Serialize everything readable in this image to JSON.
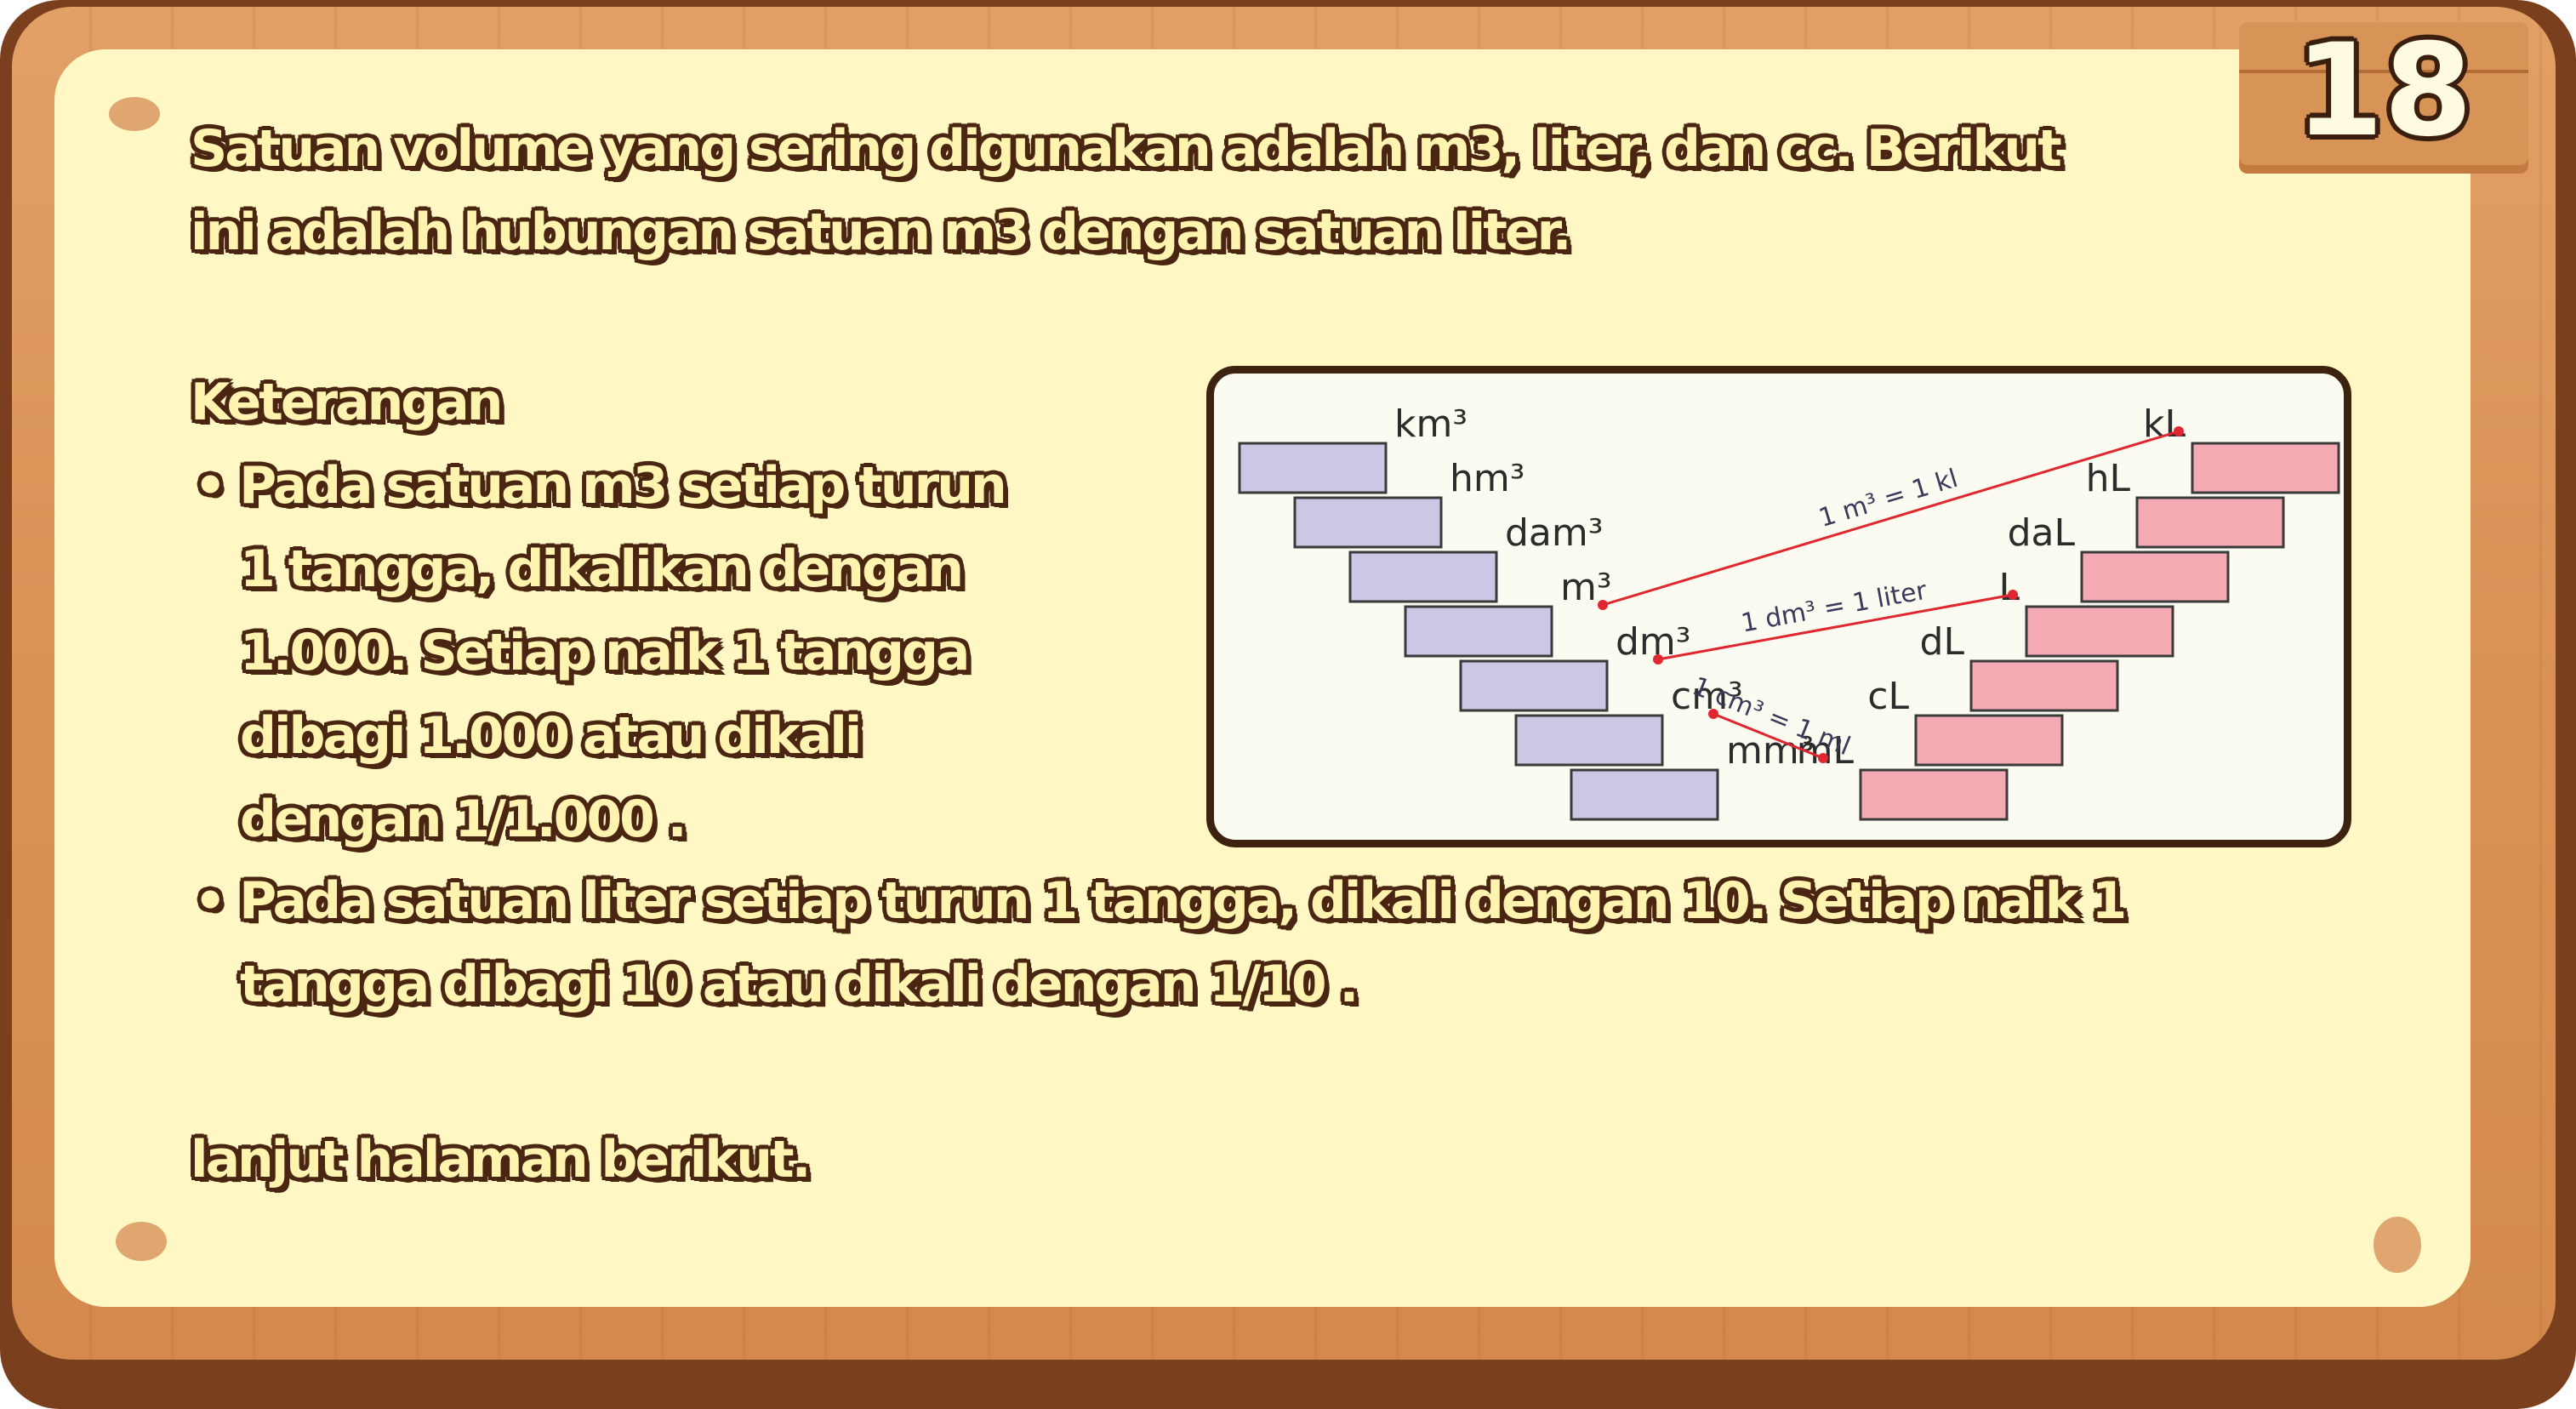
{
  "page_number": "18",
  "intro": {
    "line1": "Satuan volume yang sering digunakan adalah m3, liter, dan cc. Berikut",
    "line2": "ini adalah hubungan satuan m3 dengan satuan liter."
  },
  "keterangan": {
    "title": "Keterangan",
    "bullet1": [
      "• Pada satuan m3 setiap turun",
      "1 tangga, dikalikan dengan",
      "1.000. Setiap naik 1 tangga",
      "dibagi 1.000 atau dikali",
      "dengan 1/1.000 ."
    ],
    "bullet2": [
      "• Pada satuan liter setiap turun 1 tangga, dikali dengan 10. Setiap naik 1",
      "tangga dibagi 10 atau dikali dengan 1/10 ."
    ]
  },
  "outro": "lanjut halaman berikut.",
  "diagram": {
    "volume_units": [
      "km³",
      "hm³",
      "dam³",
      "m³",
      "dm³",
      "cm³",
      "mm³"
    ],
    "liter_units": [
      "kL",
      "hL",
      "daL",
      "L",
      "dL",
      "cL",
      "mL"
    ],
    "relations": [
      "1 m³ = 1 kl",
      "1 dm³ = 1 liter",
      "1 cm³ = 1 ml"
    ],
    "colors": {
      "volume_step": "#cbc8e6",
      "liter_step": "#f4aab3",
      "relation_line": "#e0262e",
      "frame": "#3e2210"
    }
  }
}
